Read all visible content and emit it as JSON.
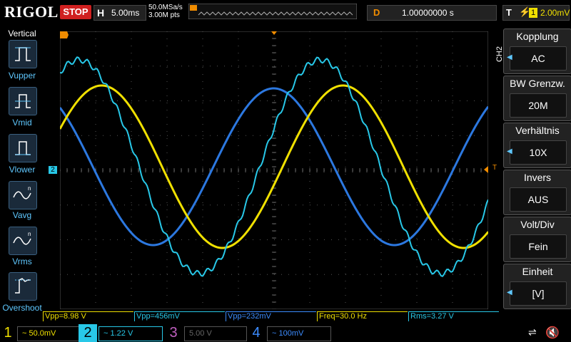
{
  "header": {
    "brand": "RIGOL",
    "run_status": "STOP",
    "timebase_label": "H",
    "timebase_value": "5.00ms",
    "sample_rate": "50.0MSa/s",
    "memory_depth": "3.00M pts",
    "delay_label": "D",
    "delay_value": "1.00000000 s",
    "trigger_label": "T",
    "trigger_source": "1",
    "trigger_level": "2.00mV"
  },
  "left_menu": {
    "title": "Vertical",
    "items": [
      {
        "label": "Vupper",
        "icon": "vupper-icon"
      },
      {
        "label": "Vmid",
        "icon": "vmid-icon"
      },
      {
        "label": "Vlower",
        "icon": "vlower-icon"
      },
      {
        "label": "Vavg",
        "icon": "vavg-icon"
      },
      {
        "label": "Vrms",
        "icon": "vrms-icon"
      },
      {
        "label": "Overshoot",
        "icon": "overshoot-icon"
      }
    ]
  },
  "right_menu": {
    "channel": "CH2",
    "items": [
      {
        "title": "Kopplung",
        "value": "AC",
        "has_arrow": true
      },
      {
        "title": "BW Grenzw.",
        "value": "20M",
        "has_arrow": false
      },
      {
        "title": "Verhältnis",
        "value": "10X",
        "has_arrow": true
      },
      {
        "title": "Invers",
        "value": "AUS",
        "has_arrow": false
      },
      {
        "title": "Volt/Div",
        "value": "Fein",
        "has_arrow": false
      },
      {
        "title": "Einheit",
        "value": "[V]",
        "has_arrow": true
      }
    ]
  },
  "measurements": [
    {
      "text": "Vpp=8.98 V",
      "color": "#f0e000"
    },
    {
      "text": "Vpp=456mV",
      "color": "#28c8e8"
    },
    {
      "text": "Vpp=232mV",
      "color": "#3c8cff"
    },
    {
      "text": "Freq=30.0 Hz",
      "color": "#f0e000"
    },
    {
      "text": "Rms=3.27 V",
      "color": "#28c8e8"
    }
  ],
  "channels": [
    {
      "num": "1",
      "value": "~ 50.0mV",
      "color": "#f0e000",
      "active": false
    },
    {
      "num": "2",
      "value": "~ 1.22 V",
      "color": "#28c8e8",
      "active": true
    },
    {
      "num": "3",
      "value": "5.00 V",
      "color": "#c060c0",
      "active": false
    },
    {
      "num": "4",
      "value": "~ 100mV",
      "color": "#3c8cff",
      "active": false
    }
  ],
  "markers": {
    "ch2_marker": "2",
    "trigger_marker": "T"
  },
  "colors": {
    "ch1": "#f0e000",
    "ch2": "#28c8e8",
    "ch4": "#2c78e0",
    "accent": "#f08c00",
    "stop": "#d02020"
  }
}
